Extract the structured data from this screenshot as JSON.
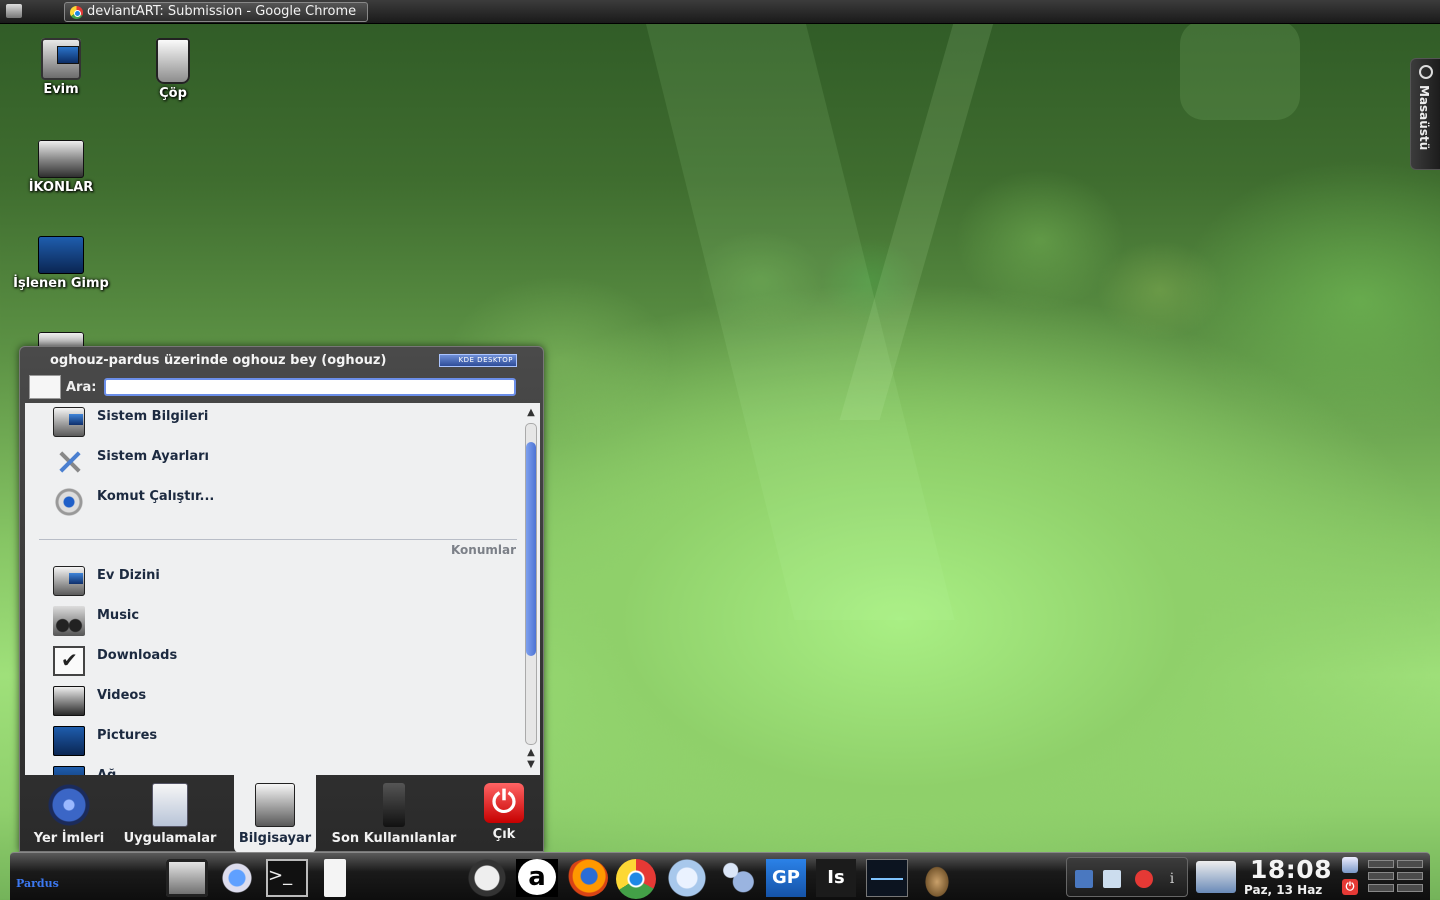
{
  "window_task": {
    "title": "deviantART: Submission - Google Chrome"
  },
  "desktop_icons": [
    {
      "label": "Evim"
    },
    {
      "label": "Çöp"
    },
    {
      "label": "İKONLAR"
    },
    {
      "label": "İşlenen Gimp"
    }
  ],
  "side_widget": {
    "label": "Masaüstü"
  },
  "kickoff": {
    "header": "oghouz-pardus üzerinde oghouz bey (oghouz)",
    "badge": "KDE DESKTOP",
    "search": {
      "label": "Ara:",
      "value": "",
      "placeholder": ""
    },
    "items": [
      {
        "label": "Sistem Bilgileri",
        "icon": "computer-icon"
      },
      {
        "label": "Sistem Ayarları",
        "icon": "tools-icon"
      },
      {
        "label": "Komut Çalıştır...",
        "icon": "gear-icon"
      }
    ],
    "section_title": "Konumlar",
    "places": [
      {
        "label": "Ev Dizini",
        "icon": "computer-icon"
      },
      {
        "label": "Music",
        "icon": "music-folder-icon"
      },
      {
        "label": "Downloads",
        "icon": "downloads-folder-icon"
      },
      {
        "label": "Videos",
        "icon": "video-folder-icon"
      },
      {
        "label": "Pictures",
        "icon": "pictures-folder-icon"
      },
      {
        "label": "Ağ",
        "icon": "network-icon"
      }
    ],
    "tabs": [
      {
        "label": "Yer İmleri",
        "icon": "bookmark-star-icon"
      },
      {
        "label": "Uygulamalar",
        "icon": "applications-icon"
      },
      {
        "label": "Bilgisayar",
        "icon": "computer-icon"
      },
      {
        "label": "Son Kullanılanlar",
        "icon": "hourglass-icon"
      },
      {
        "label": "Çık",
        "icon": "power-icon"
      }
    ],
    "active_tab": "Bilgisayar"
  },
  "panel": {
    "launcher_logo": "Pardus",
    "quick_launch": [
      "monitor-icon",
      "network-icon",
      "terminal-icon",
      "document-icon",
      "chat-icon",
      "amarok-icon",
      "firefox-icon",
      "chrome-icon",
      "thunderbird-icon",
      "messenger-icon",
      "gimp-icon",
      "inkscape-icon",
      "system-monitor-icon",
      "hand-icon"
    ],
    "gimp_label": "GP",
    "is_label": "Is",
    "terminal_label": ">_",
    "amarok_label": "a",
    "clock": {
      "time": "18:08",
      "date": "Paz, 13 Haz"
    },
    "leave_symbol": "⏻",
    "info_symbol": "i"
  }
}
